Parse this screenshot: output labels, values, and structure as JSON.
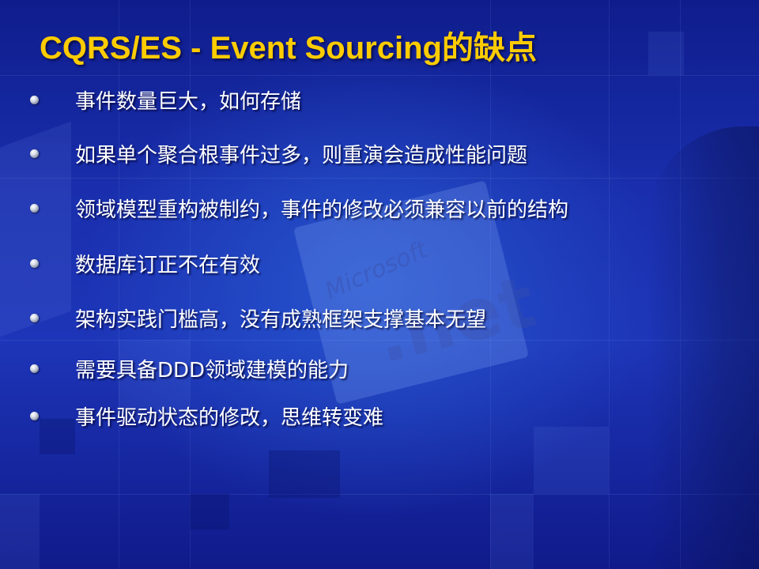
{
  "slide": {
    "title": "CQRS/ES - Event Sourcing的缺点",
    "title_color": "#ffcc00",
    "text_color": "#ffffff",
    "background_color": "#1a2fae",
    "bullets": [
      "事件数量巨大，如何存储",
      "如果单个聚合根事件过多，则重演会造成性能问题",
      "领域模型重构被制约，事件的修改必须兼容以前的结构",
      "数据库订正不在有效",
      "架构实践门槛高，没有成熟框架支撑基本无望",
      "需要具备DDD领域建模的能力",
      "事件驱动状态的修改，思维转变难"
    ],
    "bullet_icon": "sphere-bullet-icon"
  }
}
